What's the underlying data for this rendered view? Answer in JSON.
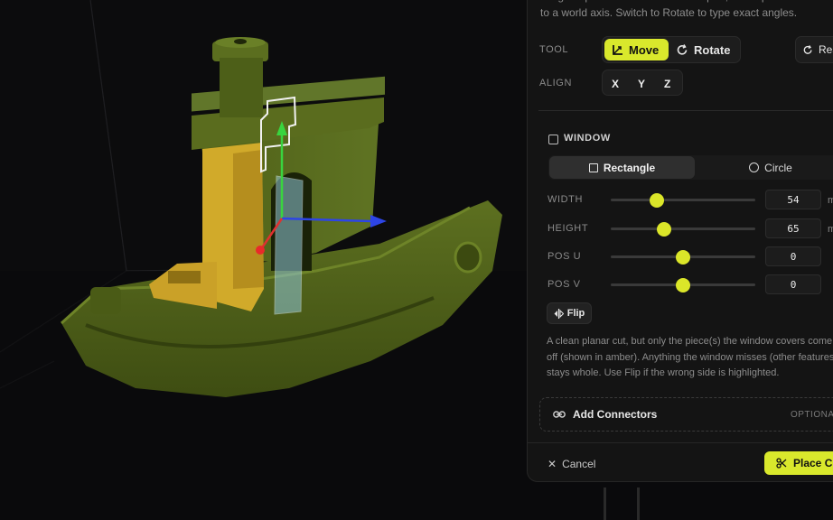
{
  "viewport": {
    "model": "boat-3d-model",
    "colors": {
      "hull": "#55661a",
      "highlight": "#d1aa2a",
      "background": "#0c0c0d"
    }
  },
  "panel": {
    "hint": "Drag the plane handles in the viewport, or snap the cut normal to a world axis. Switch to Rotate to type exact angles.",
    "tool": {
      "label": "TOOL",
      "move_label": "Move",
      "rotate_label": "Rotate",
      "reset_label": "Reset"
    },
    "align": {
      "label": "ALIGN",
      "axes": [
        "X",
        "Y",
        "Z"
      ]
    },
    "window": {
      "label": "WINDOW",
      "checked": false,
      "shape_options": [
        "Rectangle",
        "Circle"
      ],
      "selected_shape": "Rectangle",
      "fields": [
        {
          "label": "WIDTH",
          "value": "54",
          "unit": "mm",
          "slider_fraction": 0.32
        },
        {
          "label": "HEIGHT",
          "value": "65",
          "unit": "mm",
          "slider_fraction": 0.37
        },
        {
          "label": "POS U",
          "value": "0",
          "unit": "",
          "slider_fraction": 0.5
        },
        {
          "label": "POS V",
          "value": "0",
          "unit": "",
          "slider_fraction": 0.5
        }
      ],
      "flip_label": "Flip",
      "description": "A clean planar cut, but only the piece(s) the window covers come off (shown in amber). Anything the window misses (other features) stays whole. Use Flip if the wrong side is highlighted."
    },
    "connectors": {
      "label": "Add Connectors",
      "tag": "OPTIONAL"
    },
    "footer": {
      "cancel_label": "Cancel",
      "place_label": "Place Cut"
    },
    "accent_color": "#d9e82c"
  }
}
